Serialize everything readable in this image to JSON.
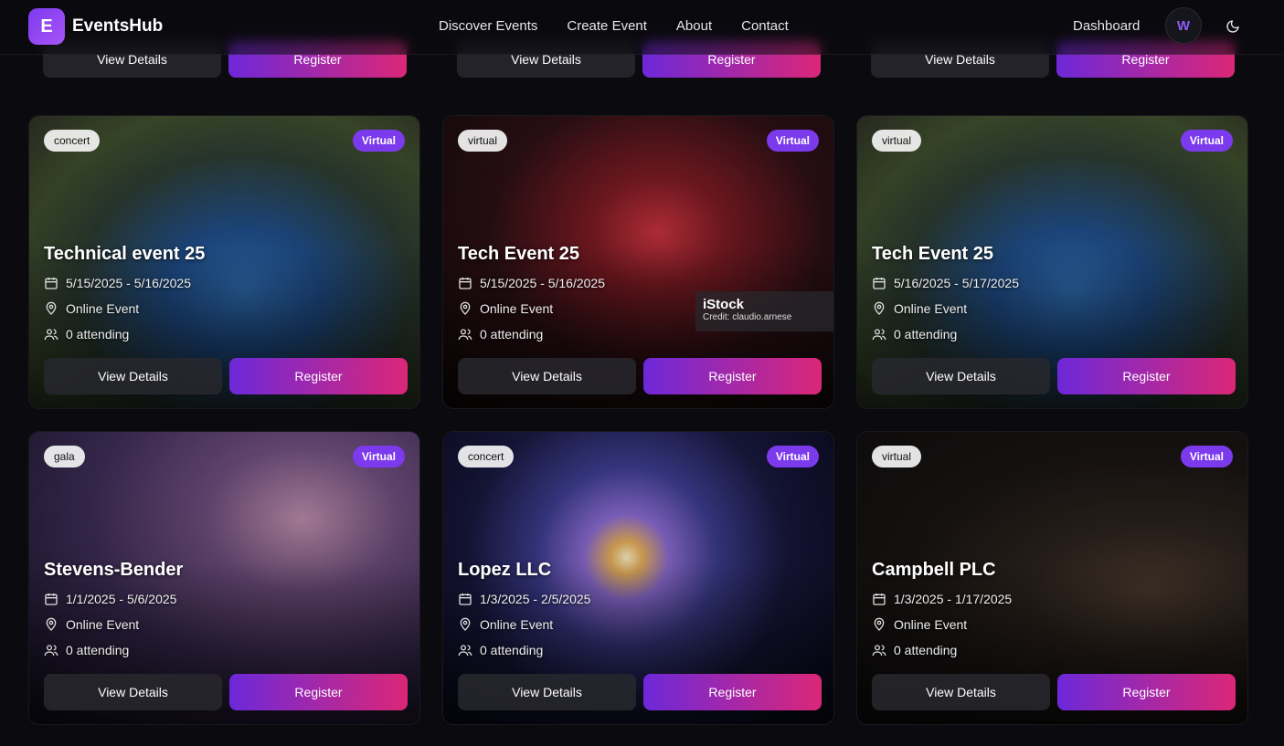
{
  "nav": {
    "logo_letter": "E",
    "brand": "EventsHub",
    "links": [
      "Discover Events",
      "Create Event",
      "About",
      "Contact"
    ],
    "dashboard": "Dashboard",
    "avatar_letter": "W"
  },
  "partial_row": [
    {
      "view": "View Details",
      "register": "Register"
    },
    {
      "view": "View Details",
      "register": "Register"
    },
    {
      "view": "View Details",
      "register": "Register"
    }
  ],
  "cards": [
    {
      "tag": "concert",
      "mode": "Virtual",
      "title": "Technical event 25",
      "dates": "5/15/2025 - 5/16/2025",
      "location": "Online Event",
      "attending": "0 attending",
      "view": "View Details",
      "register": "Register"
    },
    {
      "tag": "virtual",
      "mode": "Virtual",
      "title": "Tech Event 25",
      "dates": "5/15/2025 - 5/16/2025",
      "location": "Online Event",
      "attending": "0 attending",
      "view": "View Details",
      "register": "Register",
      "watermark_brand": "iStock",
      "watermark_credit": "Credit: claudio.arnese"
    },
    {
      "tag": "virtual",
      "mode": "Virtual",
      "title": "Tech Event 25",
      "dates": "5/16/2025 - 5/17/2025",
      "location": "Online Event",
      "attending": "0 attending",
      "view": "View Details",
      "register": "Register"
    },
    {
      "tag": "gala",
      "mode": "Virtual",
      "title": "Stevens-Bender",
      "dates": "1/1/2025 - 5/6/2025",
      "location": "Online Event",
      "attending": "0 attending",
      "view": "View Details",
      "register": "Register"
    },
    {
      "tag": "concert",
      "mode": "Virtual",
      "title": "Lopez LLC",
      "dates": "1/3/2025 - 2/5/2025",
      "location": "Online Event",
      "attending": "0 attending",
      "view": "View Details",
      "register": "Register"
    },
    {
      "tag": "virtual",
      "mode": "Virtual",
      "title": "Campbell PLC",
      "dates": "1/3/2025 - 1/17/2025",
      "location": "Online Event",
      "attending": "0 attending",
      "view": "View Details",
      "register": "Register"
    }
  ]
}
